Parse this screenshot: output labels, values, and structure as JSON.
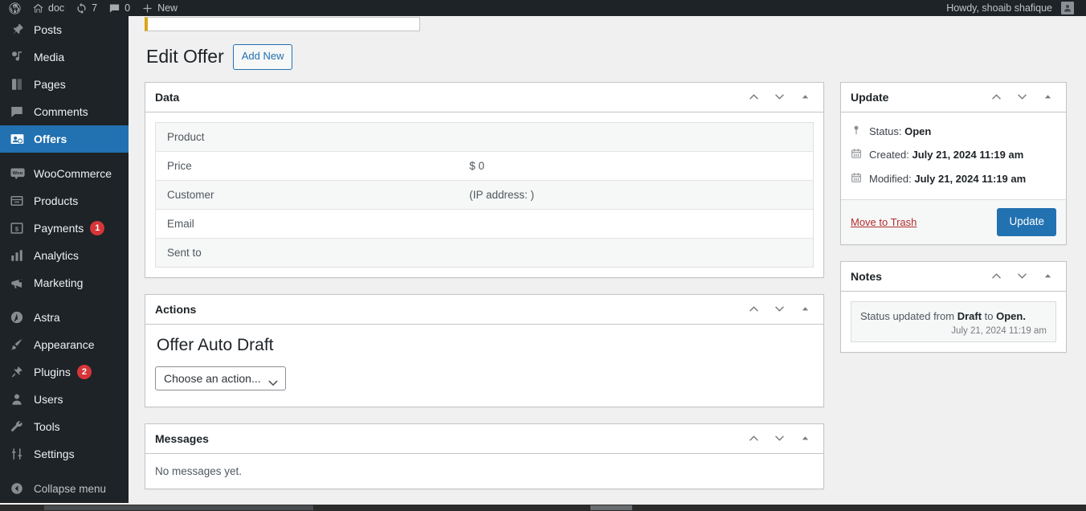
{
  "adminbar": {
    "logo_icon": "wordpress-logo-icon",
    "site_name": "doc",
    "updates_icon": "updates-icon",
    "updates_count": "7",
    "comments_icon": "comments-icon",
    "comments_count": "0",
    "new_icon": "plus-icon",
    "new_label": "New",
    "howdy": "Howdy, shoaib shafique",
    "avatar_icon": "user-avatar-icon"
  },
  "sidebar": {
    "items": [
      {
        "label": "Posts",
        "icon": "pin-icon",
        "current": false,
        "badge": ""
      },
      {
        "label": "Media",
        "icon": "media-icon",
        "current": false,
        "badge": ""
      },
      {
        "label": "Pages",
        "icon": "pages-icon",
        "current": false,
        "badge": ""
      },
      {
        "label": "Comments",
        "icon": "comment-bubble-icon",
        "current": false,
        "badge": ""
      },
      {
        "label": "Offers",
        "icon": "offers-icon",
        "current": true,
        "badge": ""
      },
      {
        "label": "WooCommerce",
        "icon": "woocommerce-icon",
        "current": false,
        "badge": ""
      },
      {
        "label": "Products",
        "icon": "products-icon",
        "current": false,
        "badge": ""
      },
      {
        "label": "Payments",
        "icon": "payments-icon",
        "current": false,
        "badge": "1"
      },
      {
        "label": "Analytics",
        "icon": "analytics-bar-icon",
        "current": false,
        "badge": ""
      },
      {
        "label": "Marketing",
        "icon": "megaphone-icon",
        "current": false,
        "badge": ""
      },
      {
        "label": "Astra",
        "icon": "astra-icon",
        "current": false,
        "badge": ""
      },
      {
        "label": "Appearance",
        "icon": "paintbrush-icon",
        "current": false,
        "badge": ""
      },
      {
        "label": "Plugins",
        "icon": "plug-icon",
        "current": false,
        "badge": "2"
      },
      {
        "label": "Users",
        "icon": "user-icon",
        "current": false,
        "badge": ""
      },
      {
        "label": "Tools",
        "icon": "wrench-icon",
        "current": false,
        "badge": ""
      },
      {
        "label": "Settings",
        "icon": "sliders-icon",
        "current": false,
        "badge": ""
      }
    ],
    "collapse": {
      "label": "Collapse menu",
      "icon": "collapse-arrow-icon"
    }
  },
  "page": {
    "title": "Edit Offer",
    "add_new_label": "Add New"
  },
  "handle_icons": {
    "up": "chevron-up-icon",
    "down": "chevron-down-icon",
    "toggle": "toggle-triangle-icon"
  },
  "data_panel": {
    "title": "Data",
    "rows": [
      {
        "label": "Product",
        "value": ""
      },
      {
        "label": "Price",
        "value": "$ 0"
      },
      {
        "label": "Customer",
        "value": "(IP address: )"
      },
      {
        "label": "Email",
        "value": ""
      },
      {
        "label": "Sent to",
        "value": ""
      }
    ]
  },
  "actions_panel": {
    "title": "Actions",
    "offer_status": "Offer Auto Draft",
    "select_value": "Choose an action...",
    "select_options": [
      "Choose an action..."
    ]
  },
  "messages_panel": {
    "title": "Messages",
    "empty_text": "No messages yet."
  },
  "update_panel": {
    "title": "Update",
    "status_label": "Status:",
    "status_value": "Open",
    "created_label": "Created:",
    "created_value": "July 21, 2024 11:19 am",
    "modified_label": "Modified:",
    "modified_value": "July 21, 2024 11:19 am",
    "trash_label": "Move to Trash",
    "update_button": "Update"
  },
  "notes_panel": {
    "title": "Notes",
    "notes": [
      {
        "text_before": "Status updated from ",
        "from": "Draft",
        "text_mid": " to ",
        "to": "Open.",
        "date": "July 21, 2024 11:19 am"
      }
    ]
  },
  "colors": {
    "admin_bar": "#1d2327",
    "accent": "#2271b1",
    "badge_red": "#d63638",
    "notice_yellow": "#dba617",
    "trash_red": "#b32d2e",
    "body_bg": "#f0f0f1"
  }
}
